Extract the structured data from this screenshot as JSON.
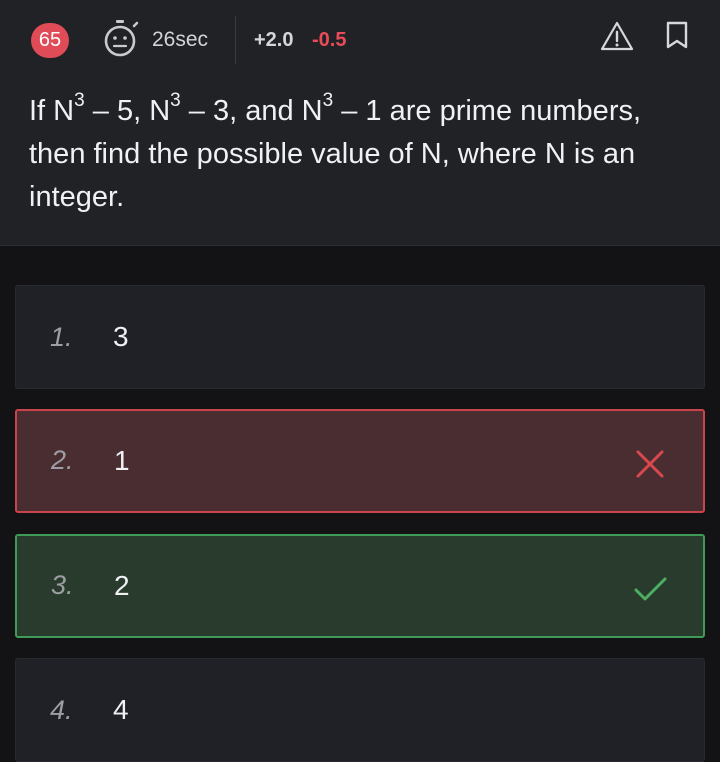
{
  "header": {
    "question_number": "65",
    "timer": "26sec",
    "positive_marks": "+2.0",
    "negative_marks": "-0.5",
    "colors": {
      "badge": "#e04b58",
      "negative": "#ea4b58"
    }
  },
  "question": {
    "parts": [
      "If N",
      "3",
      " – 5, N",
      "3",
      " – 3, and N",
      "3",
      " – 1 are prime numbers, then find the possible value of N, where N is an integer."
    ]
  },
  "options": [
    {
      "number": "1.",
      "value": "3",
      "state": "neutral"
    },
    {
      "number": "2.",
      "value": "1",
      "state": "wrong"
    },
    {
      "number": "3.",
      "value": "2",
      "state": "correct"
    },
    {
      "number": "4.",
      "value": "4",
      "state": "neutral"
    }
  ],
  "icons": {
    "timer": "stopwatch-face-icon",
    "report": "warning-triangle-icon",
    "bookmark": "bookmark-icon",
    "wrong": "cross-icon",
    "correct": "check-icon"
  },
  "state_colors": {
    "wrong": "#c9454b",
    "correct": "#3f9a57"
  }
}
